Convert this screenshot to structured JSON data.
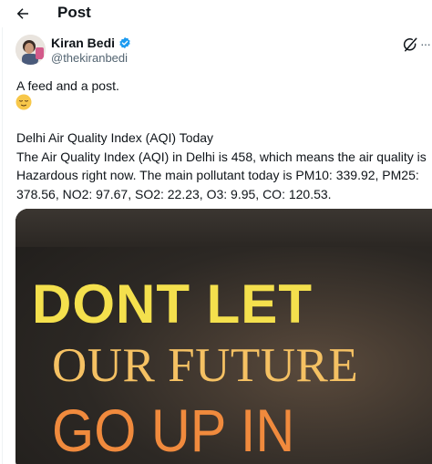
{
  "header": {
    "title": "Post",
    "back_icon": "arrow-left-icon"
  },
  "author": {
    "name": "Kiran Bedi",
    "handle": "@thekiranbedi",
    "verified": true,
    "verified_color": "#1d9bf0"
  },
  "actions": {
    "grok_icon": "grok-icon",
    "more_label": "···"
  },
  "post": {
    "text": "A feed and a post.",
    "emoji": "relieved-face-emoji",
    "aqi_lines": [
      "Delhi Air Quality Index (AQI) Today",
      "The Air Quality Index (AQI) in Delhi is 458, which means the air quality is",
      "Hazardous right now. The main pollutant today is PM10: 339.92, PM25:",
      "378.56, NO2: 97.67, SO2: 22.23, O3: 9.95, CO: 120.53."
    ]
  },
  "media": {
    "line1": "DONT LET",
    "line2": "OUR FUTURE",
    "line3": "GO UP IN",
    "colors": {
      "line1": "#f4e04d",
      "line2": "#f5c163",
      "line3": "#f08a3d"
    }
  }
}
